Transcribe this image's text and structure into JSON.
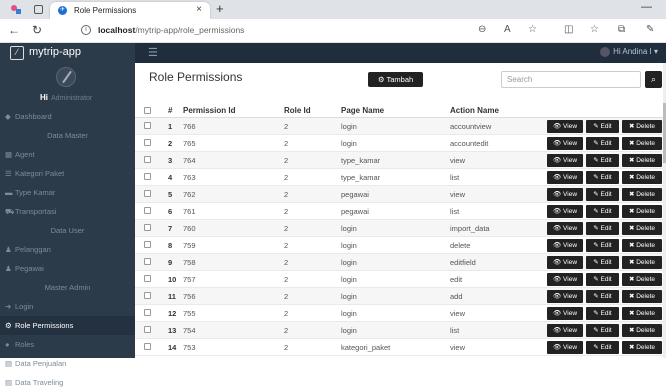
{
  "browser": {
    "tab_title": "Role Permissions",
    "tab_close": "×",
    "new_tab": "+",
    "minimize": "—",
    "url_host": "localhost",
    "url_path": "/mytrip-app/role_permissions"
  },
  "app": {
    "logo_text": "mytrip-app",
    "user_label": "Hi Andina I ▾",
    "menu_icon": "hamburger-icon"
  },
  "profile": {
    "name": "Hi",
    "role": "Administrator"
  },
  "sidebar": {
    "items": [
      {
        "label": "Dashboard",
        "icon": "◆",
        "type": "item"
      },
      {
        "label": "Data Master",
        "icon": "",
        "type": "sub"
      },
      {
        "label": "Agent",
        "icon": "▦",
        "type": "item"
      },
      {
        "label": "Kategori Paket",
        "icon": "☰",
        "type": "item"
      },
      {
        "label": "Type Kamar",
        "icon": "▬",
        "type": "item"
      },
      {
        "label": "Transportasi",
        "icon": "⛟",
        "type": "item"
      },
      {
        "label": "Data User",
        "icon": "",
        "type": "sub"
      },
      {
        "label": "Pelanggan",
        "icon": "♟",
        "type": "item"
      },
      {
        "label": "Pegawai",
        "icon": "♟",
        "type": "item"
      },
      {
        "label": "Master Admin",
        "icon": "",
        "type": "sub"
      },
      {
        "label": "Login",
        "icon": "➜",
        "type": "item"
      },
      {
        "label": "Role Permissions",
        "icon": "⚙",
        "type": "active"
      },
      {
        "label": "Roles",
        "icon": "●",
        "type": "item"
      },
      {
        "label": "Data Penjualan",
        "icon": "▤",
        "type": "item"
      },
      {
        "label": "Data Traveling",
        "icon": "▤",
        "type": "item"
      }
    ]
  },
  "main": {
    "title": "Role Permissions",
    "add_label": "⚙ Tambah",
    "search_placeholder": "Search",
    "search_icon": "🔍"
  },
  "table": {
    "headers": {
      "no": "#",
      "permission_id": "Permission Id",
      "role_id": "Role Id",
      "page_name": "Page Name",
      "action_name": "Action Name"
    },
    "view_label": "👁 View",
    "edit_label": "✎ Edit",
    "delete_label": "✖ Delete",
    "rows": [
      {
        "no": "1",
        "permission_id": "766",
        "role_id": "2",
        "page_name": "login",
        "action_name": "accountview"
      },
      {
        "no": "2",
        "permission_id": "765",
        "role_id": "2",
        "page_name": "login",
        "action_name": "accountedit"
      },
      {
        "no": "3",
        "permission_id": "764",
        "role_id": "2",
        "page_name": "type_kamar",
        "action_name": "view"
      },
      {
        "no": "4",
        "permission_id": "763",
        "role_id": "2",
        "page_name": "type_kamar",
        "action_name": "list"
      },
      {
        "no": "5",
        "permission_id": "762",
        "role_id": "2",
        "page_name": "pegawai",
        "action_name": "view"
      },
      {
        "no": "6",
        "permission_id": "761",
        "role_id": "2",
        "page_name": "pegawai",
        "action_name": "list"
      },
      {
        "no": "7",
        "permission_id": "760",
        "role_id": "2",
        "page_name": "login",
        "action_name": "import_data"
      },
      {
        "no": "8",
        "permission_id": "759",
        "role_id": "2",
        "page_name": "login",
        "action_name": "delete"
      },
      {
        "no": "9",
        "permission_id": "758",
        "role_id": "2",
        "page_name": "login",
        "action_name": "editfield"
      },
      {
        "no": "10",
        "permission_id": "757",
        "role_id": "2",
        "page_name": "login",
        "action_name": "edit"
      },
      {
        "no": "11",
        "permission_id": "756",
        "role_id": "2",
        "page_name": "login",
        "action_name": "add"
      },
      {
        "no": "12",
        "permission_id": "755",
        "role_id": "2",
        "page_name": "login",
        "action_name": "view"
      },
      {
        "no": "13",
        "permission_id": "754",
        "role_id": "2",
        "page_name": "login",
        "action_name": "list"
      },
      {
        "no": "14",
        "permission_id": "753",
        "role_id": "2",
        "page_name": "kategori_paket",
        "action_name": "view"
      }
    ]
  }
}
